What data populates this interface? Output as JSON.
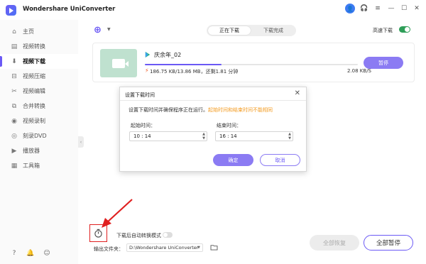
{
  "window": {
    "title": "Wondershare UniConverter",
    "controls": [
      "—",
      "☐",
      "✕"
    ]
  },
  "sidebar": {
    "items": [
      {
        "label": "主页",
        "icon": "home-icon"
      },
      {
        "label": "视频转换",
        "icon": "convert-icon"
      },
      {
        "label": "视频下载",
        "icon": "download-icon",
        "active": true
      },
      {
        "label": "视频压缩",
        "icon": "compress-icon"
      },
      {
        "label": "视频编辑",
        "icon": "edit-icon"
      },
      {
        "label": "合并转换",
        "icon": "merge-icon"
      },
      {
        "label": "视频录制",
        "icon": "record-icon"
      },
      {
        "label": "刻录DVD",
        "icon": "dvd-icon"
      },
      {
        "label": "播放器",
        "icon": "player-icon"
      },
      {
        "label": "工具箱",
        "icon": "toolbox-icon"
      }
    ],
    "bottom_icons": [
      "help-icon",
      "bell-icon",
      "feedback-icon"
    ]
  },
  "main": {
    "tabs": [
      {
        "label": "正在下载",
        "active": true
      },
      {
        "label": "下载完成",
        "active": false
      }
    ],
    "high_speed_label": "高速下载",
    "high_speed_on": true
  },
  "download": {
    "title": "庆余年_02",
    "progress": 0.36,
    "stats": "186.75 KB/13.86 MB，还剩1.81 分钟",
    "speed": "2.08 KB/S",
    "pause_label": "暂停"
  },
  "dialog": {
    "title": "设置下载时间",
    "message": "设置下载时间并确保程序正在运行。",
    "warning": "起始时间和结束时间不能相同",
    "start_label": "起始时间：",
    "start_value": "10 : 14",
    "end_label": "结束时间：",
    "end_value": "16 : 14",
    "ok_label": "确定",
    "cancel_label": "取消"
  },
  "bottom": {
    "auto_convert_label": "下载后自动转换模式",
    "output_label": "输出文件夹：",
    "output_path": "D:\\Wondershare UniConverter",
    "resume_all": "全部恢复",
    "pause_all": "全部暂停"
  },
  "colors": {
    "accent": "#6b59f5",
    "button_fill": "#8b7bf3",
    "warning": "#f39a1e",
    "toggle_on": "#2e9e58",
    "annotation": "#e02020"
  }
}
